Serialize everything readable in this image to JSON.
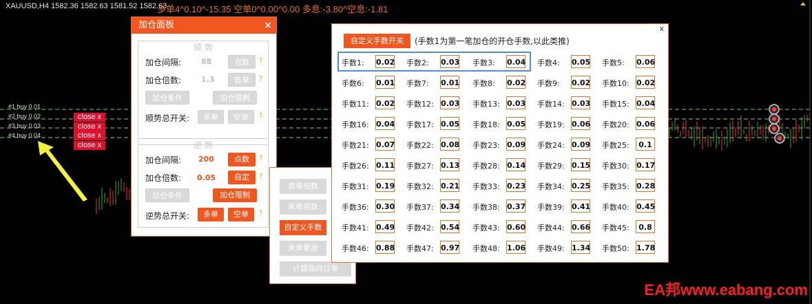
{
  "chart": {
    "symbol_info": "XAUUSD,H4  1582.36 1582.63 1581.52 1582.63",
    "stats_text": "多单4^0.10^-15.35   空单0^0.00^0.00   多息:-3.80^空息:-1.81",
    "orders": [
      "#1 buy 0.01",
      "#2 buy 0.02",
      "#3 buy 0.03",
      "#4 buy 0.04"
    ],
    "close_label": "close x",
    "watermark": "EA邦www.eabang.com"
  },
  "add_panel": {
    "title": "加仓面板",
    "close_icon": "×",
    "trend": {
      "title": "顺  势",
      "interval_label": "加仓间隔:",
      "interval_value": "88",
      "interval_btn": "点数",
      "multiplier_label": "加仓倍数:",
      "multiplier_value": "1.3",
      "multiplier_btn": "首单",
      "cond_btn": "加仓条件",
      "limit_btn": "加仓限制",
      "switch_label": "顺势总开关:",
      "long_btn": "多单",
      "short_btn": "空单"
    },
    "counter": {
      "title": "逆  势",
      "interval_label": "加仓间隔:",
      "interval_value": "200",
      "interval_btn": "点数",
      "multiplier_label": "加仓倍数:",
      "multiplier_value": "0.05",
      "multiplier_btn": "自定",
      "cond_btn": "加仓条件",
      "limit_btn": "加仓限制",
      "switch_label": "逆势总开关:",
      "long_btn": "多单",
      "short_btn": "空单"
    },
    "help": "?"
  },
  "mid_panel": {
    "buttons": [
      "首单倍数",
      "末单倍数",
      "自定义手数",
      "末单累加",
      "计算双向订单"
    ]
  },
  "lot_panel": {
    "toggle_btn": "自定义手数开关",
    "note": "(手数1为第一笔加仓的开仓手数,以此类推)",
    "close": "x",
    "lots": [
      {
        "label": "手数1:",
        "value": "0.02"
      },
      {
        "label": "手数2:",
        "value": "0.03"
      },
      {
        "label": "手数3:",
        "value": "0.04"
      },
      {
        "label": "手数4:",
        "value": "0.05"
      },
      {
        "label": "手数5:",
        "value": "0.06"
      },
      {
        "label": "手数6:",
        "value": "0.01"
      },
      {
        "label": "手数7:",
        "value": "0.01"
      },
      {
        "label": "手数8:",
        "value": "0.02"
      },
      {
        "label": "手数9:",
        "value": "0.02"
      },
      {
        "label": "手数10:",
        "value": "0.02"
      },
      {
        "label": "手数11:",
        "value": "0.02"
      },
      {
        "label": "手数12:",
        "value": "0.03"
      },
      {
        "label": "手数13:",
        "value": "0.03"
      },
      {
        "label": "手数14:",
        "value": "0.03"
      },
      {
        "label": "手数15:",
        "value": "0.04"
      },
      {
        "label": "手数16:",
        "value": "0.04"
      },
      {
        "label": "手数17:",
        "value": "0.05"
      },
      {
        "label": "手数18:",
        "value": "0.05"
      },
      {
        "label": "手数19:",
        "value": "0.06"
      },
      {
        "label": "手数20:",
        "value": "0.06"
      },
      {
        "label": "手数21:",
        "value": "0.07"
      },
      {
        "label": "手数22:",
        "value": "0.08"
      },
      {
        "label": "手数23:",
        "value": "0.09"
      },
      {
        "label": "手数24:",
        "value": "0.09"
      },
      {
        "label": "手数25:",
        "value": "0.1"
      },
      {
        "label": "手数26:",
        "value": "0.11"
      },
      {
        "label": "手数27:",
        "value": "0.13"
      },
      {
        "label": "手数28:",
        "value": "0.14"
      },
      {
        "label": "手数29:",
        "value": "0.15"
      },
      {
        "label": "手数30:",
        "value": "0.17"
      },
      {
        "label": "手数31:",
        "value": "0.19"
      },
      {
        "label": "手数32:",
        "value": "0.21"
      },
      {
        "label": "手数33:",
        "value": "0.23"
      },
      {
        "label": "手数34:",
        "value": "0.25"
      },
      {
        "label": "手数35:",
        "value": "0.28"
      },
      {
        "label": "手数36:",
        "value": "0.30"
      },
      {
        "label": "手数37:",
        "value": "0.34"
      },
      {
        "label": "手数38:",
        "value": "0.37"
      },
      {
        "label": "手数39:",
        "value": "0.41"
      },
      {
        "label": "手数40:",
        "value": "0.45"
      },
      {
        "label": "手数41:",
        "value": "0.49"
      },
      {
        "label": "手数42:",
        "value": "0.54"
      },
      {
        "label": "手数43:",
        "value": "0.60"
      },
      {
        "label": "手数44:",
        "value": "0.66"
      },
      {
        "label": "手数45:",
        "value": "0.8"
      },
      {
        "label": "手数46:",
        "value": "0.88"
      },
      {
        "label": "手数47:",
        "value": "0.97"
      },
      {
        "label": "手数48:",
        "value": "1.06"
      },
      {
        "label": "手数49:",
        "value": "1.34"
      },
      {
        "label": "手数50:",
        "value": "1.78"
      }
    ]
  }
}
